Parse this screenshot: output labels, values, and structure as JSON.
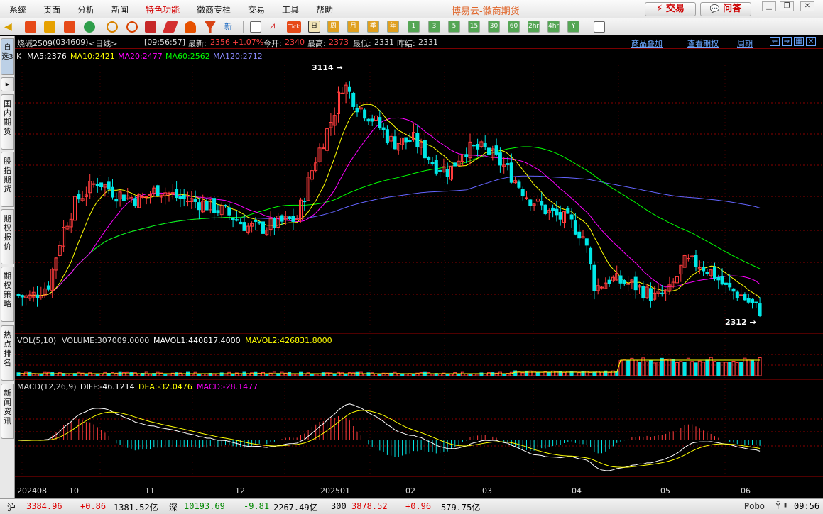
{
  "menu": [
    "系统",
    "页面",
    "分析",
    "新闻",
    "特色功能",
    "徽商专栏",
    "交易",
    "工具",
    "帮助"
  ],
  "app_title": "博易云-徽商期货",
  "top_buttons": {
    "trade": "交易",
    "qa": "问答"
  },
  "toolbar_periods": [
    "日",
    "周",
    "月",
    "季",
    "年",
    "1",
    "3",
    "5",
    "15",
    "30",
    "60",
    "2hr",
    "4hr",
    "Y"
  ],
  "sidebar_tabs": [
    "自选3",
    "国内期货",
    "股指期货",
    "期权报价",
    "期权策略",
    "热点排名",
    "新闻资讯"
  ],
  "header": {
    "symbol": "烧碱2509",
    "code": "(034609)",
    "period": "<日线>",
    "time": "[09:56:57]",
    "latest_label": "最新:",
    "latest": "2356",
    "change": "+1.07%",
    "open_label": "今开:",
    "open": "2340",
    "high_label": "最高:",
    "high": "2373",
    "low_label": "最低:",
    "low": "2331",
    "prev_label": "昨结:",
    "prev": "2331",
    "link_overlay": "商品叠加",
    "link_options": "查看期权",
    "link_period": "周期"
  },
  "ma_legend": {
    "k": "K",
    "ma5": "MA5:2376",
    "ma10": "MA10:2421",
    "ma20": "MA20:2477",
    "ma60": "MA60:2562",
    "ma120": "MA120:2712"
  },
  "annotations": {
    "high_mark": "3114",
    "low_mark": "2312"
  },
  "vol_legend": {
    "title": "VOL(5,10)",
    "volume": "VOLUME:307009.0000",
    "mavol1": "MAVOL1:440817.4000",
    "mavol2": "MAVOL2:426831.8000"
  },
  "macd_legend": {
    "title": "MACD(12,26,9)",
    "diff": "DIFF:-46.1214",
    "dea": "DEA:-32.0476",
    "macd": "MACD:-28.1477"
  },
  "x_labels": [
    "202408",
    "10",
    "11",
    "12",
    "202501",
    "02",
    "03",
    "04",
    "05",
    "06"
  ],
  "status": {
    "sh_label": "沪",
    "sh_value": "3384.96",
    "sh_change": "+0.86",
    "sh_amount": "1381.52亿",
    "sz_label": "深",
    "sz_value": "10193.69",
    "sz_change": "-9.81",
    "sz_amount": "2267.49亿",
    "c300_label": "300",
    "c300_value": "3878.52",
    "c300_change": "+0.96",
    "c300_amount": "579.75亿",
    "brand": "Pobo",
    "clock": "09:56"
  },
  "colors": {
    "up": "#ff3c3c",
    "down": "#00e6e6",
    "ma5": "#ffffff",
    "ma10": "#ffff00",
    "ma20": "#ff00ff",
    "ma60": "#00ff00",
    "ma120": "#6464ff",
    "grid": "#8b0000"
  },
  "chart_data": {
    "type": "candlestick",
    "ylim": [
      2312,
      3114
    ],
    "price_high": 3114,
    "price_low": 2312,
    "ma_last": {
      "MA5": 2376,
      "MA10": 2421,
      "MA20": 2477,
      "MA60": 2562,
      "MA120": 2712
    },
    "last_bar": {
      "open": 2340,
      "high": 2373,
      "low": 2331,
      "close": 2356,
      "volume": 307009
    },
    "macd_last": {
      "DIFF": -46.1214,
      "DEA": -32.0476,
      "MACD": -28.1477
    }
  }
}
